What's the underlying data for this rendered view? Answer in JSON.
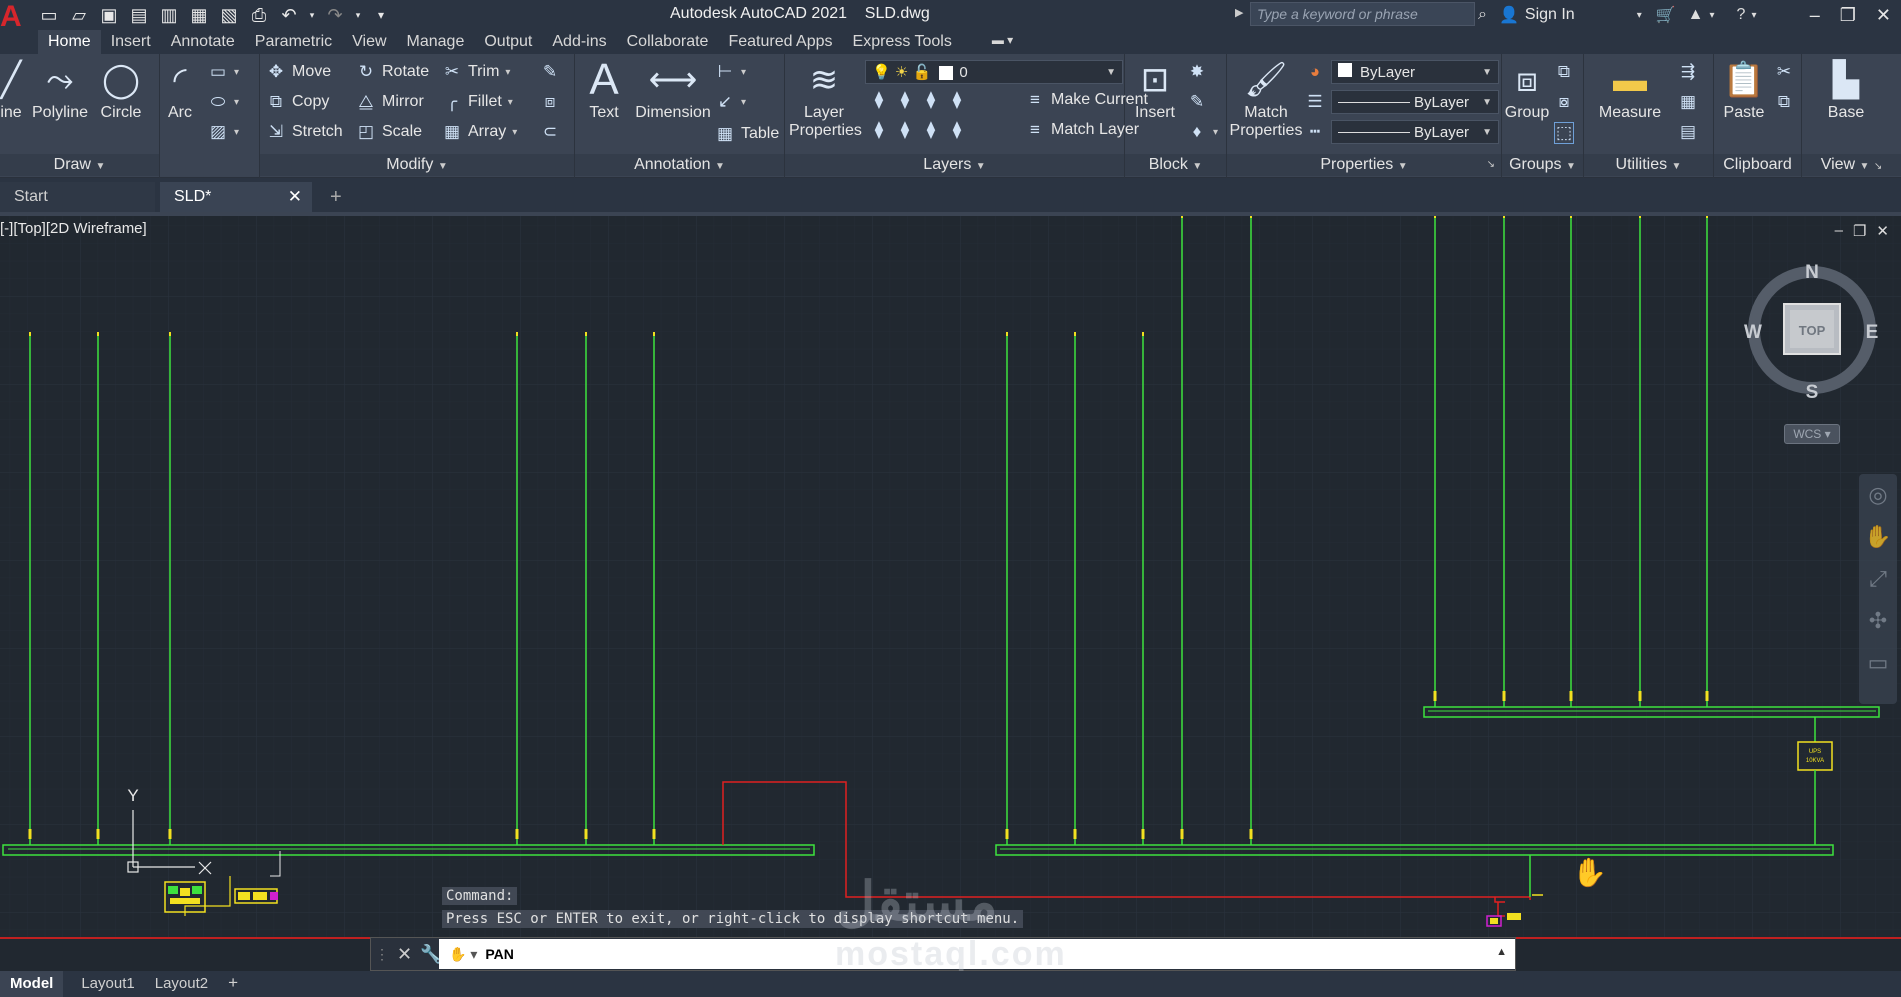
{
  "title_bar": {
    "app_title": "Autodesk AutoCAD 2021",
    "file_name": "SLD.dwg",
    "search_placeholder": "Type a keyword or phrase",
    "sign_in": "Sign In"
  },
  "ribbon_tabs": [
    "Home",
    "Insert",
    "Annotate",
    "Parametric",
    "View",
    "Manage",
    "Output",
    "Add-ins",
    "Collaborate",
    "Featured Apps",
    "Express Tools"
  ],
  "draw_panel": {
    "title": "Draw",
    "line": "ine",
    "polyline": "Polyline",
    "circle": "Circle",
    "arc": "Arc"
  },
  "modify_panel": {
    "title": "Modify",
    "move": "Move",
    "rotate": "Rotate",
    "trim": "Trim",
    "copy": "Copy",
    "mirror": "Mirror",
    "fillet": "Fillet",
    "stretch": "Stretch",
    "scale": "Scale",
    "array": "Array"
  },
  "annotation_panel": {
    "title": "Annotation",
    "text": "Text",
    "dimension": "Dimension",
    "table": "Table"
  },
  "layers_panel": {
    "title": "Layers",
    "layer_properties_1": "Layer",
    "layer_properties_2": "Properties",
    "current_layer": "0",
    "make_current": "Make Current",
    "match_layer": "Match Layer"
  },
  "block_panel": {
    "title": "Block",
    "insert": "Insert"
  },
  "properties_panel": {
    "title": "Properties",
    "match_1": "Match",
    "match_2": "Properties",
    "color": "ByLayer",
    "linetype": "ByLayer",
    "lineweight": "ByLayer"
  },
  "groups_panel": {
    "title": "Groups",
    "group": "Group"
  },
  "utilities_panel": {
    "title": "Utilities",
    "measure": "Measure"
  },
  "clipboard_panel": {
    "title": "Clipboard",
    "paste": "Paste"
  },
  "view_panel": {
    "title": "View",
    "base": "Base"
  },
  "doc_tabs": {
    "start": "Start",
    "current": "SLD*"
  },
  "viewport": {
    "label": "[-][Top][2D Wireframe]",
    "compass": {
      "n": "N",
      "s": "S",
      "e": "E",
      "w": "W",
      "cube": "TOP"
    },
    "wcs": "WCS",
    "ucs_y": "Y",
    "ups_label_1": "UPS",
    "ups_label_2": "10KVA"
  },
  "command": {
    "history_1": "Command:",
    "history_2": "Press ESC or ENTER to exit, or right-click to display shortcut menu.",
    "current": "PAN"
  },
  "layout_tabs": [
    "Model",
    "Layout1",
    "Layout2"
  ],
  "watermark": {
    "arabic": "مستقل",
    "latin": "mostaql.com"
  },
  "colors": {
    "green_line": "#3ee23e",
    "red_line": "#e02020",
    "yellow_marker": "#f2e020",
    "canvas_bg": "#212830"
  }
}
